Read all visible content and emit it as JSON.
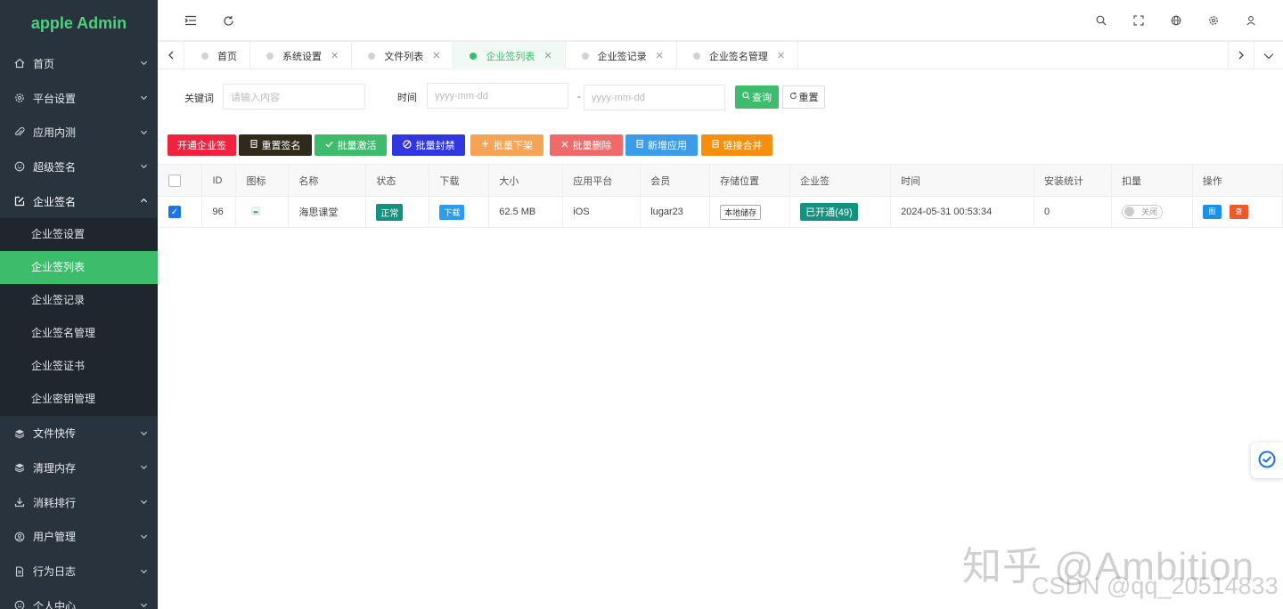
{
  "app": {
    "title": "apple Admin",
    "brand_color": "#4dd17f",
    "accent": "#3dbd6c"
  },
  "sidebar": {
    "items": [
      {
        "label": "首页",
        "icon": "home-icon"
      },
      {
        "label": "平台设置",
        "icon": "gear-icon"
      },
      {
        "label": "应用内测",
        "icon": "paperclip-icon"
      },
      {
        "label": "超级签名",
        "icon": "smile-icon"
      },
      {
        "label": "企业签名",
        "icon": "edit-icon",
        "open": true,
        "children": [
          "企业签设置",
          "企业签列表",
          "企业签记录",
          "企业签名管理",
          "企业签证书",
          "企业密钥管理"
        ]
      },
      {
        "label": "文件快传",
        "icon": "layers-icon"
      },
      {
        "label": "清理内存",
        "icon": "layers-icon"
      },
      {
        "label": "消耗排行",
        "icon": "download-icon"
      },
      {
        "label": "用户管理",
        "icon": "user-circle-icon"
      },
      {
        "label": "行为日志",
        "icon": "file-icon"
      },
      {
        "label": "个人中心",
        "icon": "smile-icon"
      }
    ],
    "active_child": "企业签列表"
  },
  "header": {
    "icons": [
      "menu-fold-icon",
      "refresh-icon",
      "search-icon",
      "fullscreen-icon",
      "globe-icon",
      "gear-icon",
      "user-icon"
    ]
  },
  "tabs": [
    {
      "label": "首页",
      "closable": false
    },
    {
      "label": "系统设置",
      "closable": true
    },
    {
      "label": "文件列表",
      "closable": true
    },
    {
      "label": "企业签列表",
      "closable": true,
      "active": true
    },
    {
      "label": "企业签记录",
      "closable": true
    },
    {
      "label": "企业签名管理",
      "closable": true
    }
  ],
  "filter": {
    "keyword_label": "关键词",
    "keyword_placeholder": "请输入内容",
    "time_label": "时间",
    "date_placeholder_start": "yyyy-mm-dd",
    "separator": "-",
    "date_placeholder_end": "yyyy-mm-dd",
    "search_label": "查询",
    "reset_label": "重置"
  },
  "batch_buttons": [
    {
      "label": "开通企业签",
      "color": "#f0233f",
      "icon": ""
    },
    {
      "label": "重置签名",
      "color": "#2f2a1a",
      "icon": "file-icon"
    },
    {
      "label": "批量激活",
      "color": "#3dbd6c",
      "icon": "check-icon"
    },
    {
      "label": "批量封禁",
      "color": "#3137e0",
      "icon": "ban-icon"
    },
    {
      "label": "批量下架",
      "color": "#f5a456",
      "icon": "plus-icon"
    },
    {
      "label": "批量删除",
      "color": "#f06a6a",
      "icon": "close-icon"
    },
    {
      "label": "新增应用",
      "color": "#3d9ce8",
      "icon": "file-icon"
    },
    {
      "label": "链接合并",
      "color": "#f68f0e",
      "icon": "file-icon"
    }
  ],
  "table": {
    "columns": [
      "ID",
      "图标",
      "名称",
      "状态",
      "下载",
      "大小",
      "应用平台",
      "会员",
      "存储位置",
      "企业签",
      "时间",
      "安装统计",
      "扣量",
      "操作"
    ],
    "rows": [
      {
        "checked": true,
        "id": "96",
        "name": "海思课堂",
        "status": "正常",
        "download": "下载",
        "size": "62.5 MB",
        "platform": "iOS",
        "member": "lugar23",
        "storage": "本地储存",
        "enterprise": "已开通(49)",
        "time": "2024-05-31 00:53:34",
        "installs": "0",
        "deduct": "关闭",
        "op_edit": "图",
        "op_delete": "查"
      }
    ]
  },
  "watermark": {
    "line1": "知乎 @Ambition",
    "line2": "CSDN @qq_20514833"
  }
}
